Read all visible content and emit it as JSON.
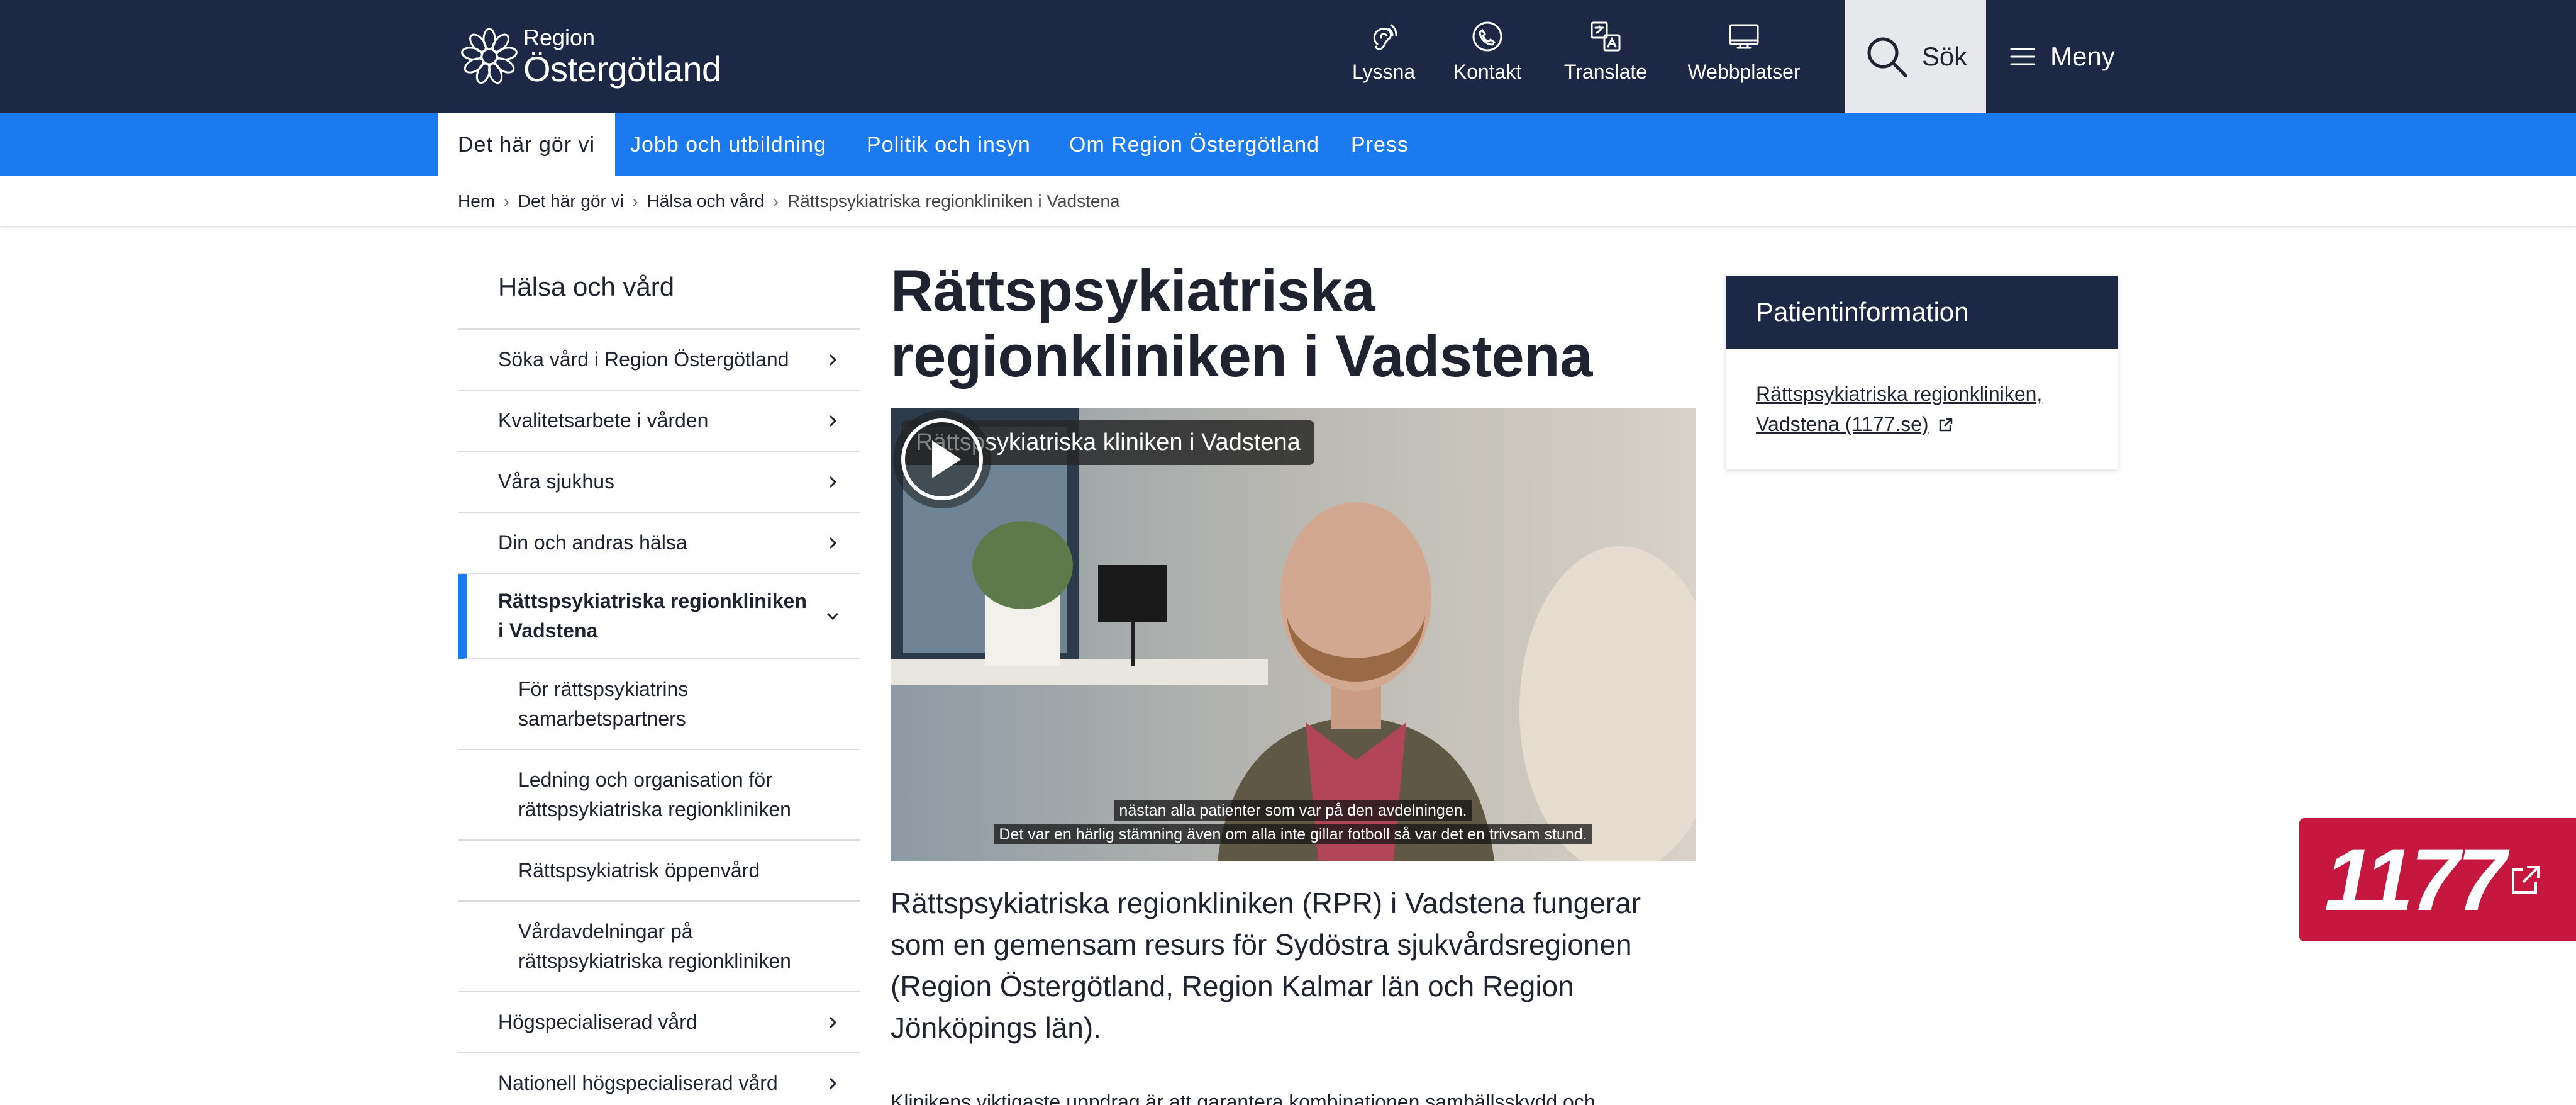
{
  "header": {
    "logo_small": "Region",
    "logo_big": "Östergötland",
    "tools": [
      {
        "label": "Lyssna",
        "icon": "ear-icon"
      },
      {
        "label": "Kontakt",
        "icon": "phone-icon"
      },
      {
        "label": "Translate",
        "icon": "translate-icon"
      },
      {
        "label": "Webbplatser",
        "icon": "monitor-icon"
      }
    ],
    "search_label": "Sök",
    "menu_label": "Meny"
  },
  "nav": {
    "items": [
      "Det här gör vi",
      "Jobb och utbildning",
      "Politik och insyn",
      "Om Region Östergötland",
      "Press"
    ],
    "active_index": 0
  },
  "breadcrumb": [
    "Hem",
    "Det här gör vi",
    "Hälsa och vård",
    "Rättspsykiatriska regionkliniken i Vadstena"
  ],
  "sidenav": {
    "heading": "Hälsa och vård",
    "items": [
      {
        "label": "Söka vård i Region Östergötland",
        "chevron": "right"
      },
      {
        "label": "Kvalitetsarbete i vården",
        "chevron": "right"
      },
      {
        "label": "Våra sjukhus",
        "chevron": "right"
      },
      {
        "label": "Din och andras hälsa",
        "chevron": "right"
      },
      {
        "label": "Rättspsykiatriska regionkliniken i Vadstena",
        "chevron": "down",
        "current": true
      },
      {
        "label": "För rättspsykiatrins samarbetspartners",
        "sub": true
      },
      {
        "label": "Ledning och organisation för rättspsykiatriska regionkliniken",
        "sub": true
      },
      {
        "label": "Rättspsykiatrisk öppenvård",
        "sub": true
      },
      {
        "label": "Vårdavdelningar på rättspsykiatriska regionkliniken",
        "sub": true
      },
      {
        "label": "Högspecialiserad vård",
        "chevron": "right"
      },
      {
        "label": "Nationell högspecialiserad vård",
        "chevron": "right"
      }
    ]
  },
  "main": {
    "title": "Rättspsykiatriska regionkliniken i Vadstena",
    "video": {
      "title": "Rättspsykiatriska kliniken i Vadstena",
      "subtitle_line1": "nästan alla patienter som var på den avdelningen.",
      "subtitle_line2": "Det var en härlig stämning även om alla inte gillar fotboll så var det en trivsam stund."
    },
    "lead": "Rättspsykiatriska regionkliniken (RPR) i Vadstena fungerar som en gemensam resurs för Sydöstra sjukvårdsregionen (Region Östergötland, Region Kalmar län och Region Jönköpings län).",
    "body": "Klinikens viktigaste uppdrag är att garantera kombinationen samhällsskydd och högspecialiserad rättspsykiatrisk vård."
  },
  "infocard": {
    "title": "Patientinformation",
    "link": "Rättspsykiatriska regionkliniken, Vadstena (1177.se)"
  },
  "badge": {
    "text": "1177"
  },
  "colors": {
    "header_bg": "#1c2846",
    "nav_bg": "#1c7af0",
    "badge_bg": "#c6173f"
  }
}
